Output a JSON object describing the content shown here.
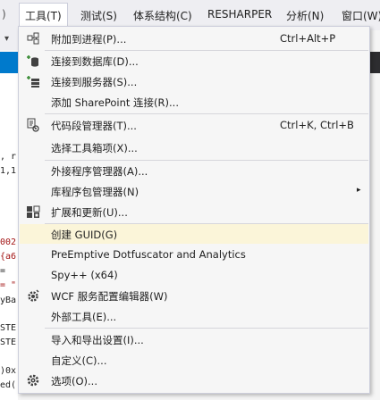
{
  "menubar": {
    "items": [
      "工具(T)",
      "测试(S)",
      "体系结构(C)",
      "RESHARPER",
      "分析(N)",
      "窗口(W)"
    ]
  },
  "editor": {
    "lines": [
      ", r",
      "1,1",
      "002",
      "{a6",
      " = ",
      "= \"",
      "yBa",
      "STE",
      "STE",
      ")0x",
      "ed("
    ]
  },
  "menu": {
    "items": [
      {
        "label": "附加到进程(P)...",
        "shortcut": "Ctrl+Alt+P",
        "icon": "attach-process-icon"
      },
      {
        "label": "连接到数据库(D)...",
        "icon": "connect-database-icon"
      },
      {
        "label": "连接到服务器(S)...",
        "icon": "connect-server-icon"
      },
      {
        "label": "添加 SharePoint 连接(R)...",
        "icon": ""
      },
      {
        "label": "代码段管理器(T)...",
        "shortcut": "Ctrl+K, Ctrl+B",
        "icon": "snippet-manager-icon"
      },
      {
        "label": "选择工具箱项(X)...",
        "icon": ""
      },
      {
        "label": "外接程序管理器(A)...",
        "icon": ""
      },
      {
        "label": "库程序包管理器(N)",
        "submenu": true,
        "icon": ""
      },
      {
        "label": "扩展和更新(U)...",
        "icon": "extensions-icon"
      },
      {
        "label": "创建 GUID(G)",
        "icon": "",
        "highlighted": true
      },
      {
        "label": "PreEmptive Dotfuscator and Analytics",
        "icon": ""
      },
      {
        "label": "Spy++ (x64)",
        "icon": ""
      },
      {
        "label": "WCF 服务配置编辑器(W)",
        "icon": "wcf-gear-icon"
      },
      {
        "label": "外部工具(E)...",
        "icon": ""
      },
      {
        "label": "导入和导出设置(I)...",
        "icon": ""
      },
      {
        "label": "自定义(C)...",
        "icon": ""
      },
      {
        "label": "选项(O)...",
        "icon": "options-gear-icon"
      }
    ],
    "submenu_arrow": "▸"
  }
}
